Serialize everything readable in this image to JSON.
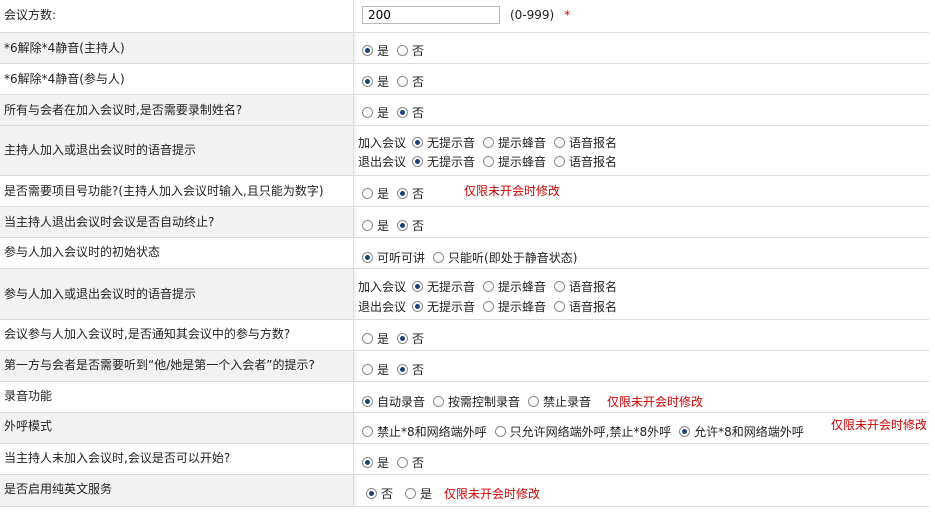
{
  "rows": [
    {
      "label": "会议方数:",
      "input_value": "200",
      "hint": "(0-999)",
      "required_mark": "*"
    },
    {
      "label": "*6解除*4静音(主持人)",
      "options": [
        "是",
        "否"
      ]
    },
    {
      "label": "*6解除*4静音(参与人)",
      "options": [
        "是",
        "否"
      ]
    },
    {
      "label": "所有与会者在加入会议时,是否需要录制姓名?",
      "options": [
        "是",
        "否"
      ]
    },
    {
      "label": "主持人加入或退出会议时的语音提示",
      "lines": [
        {
          "prefix": "加入会议",
          "options": [
            "无提示音",
            "提示蜂音",
            "语音报名"
          ]
        },
        {
          "prefix": "退出会议",
          "options": [
            "无提示音",
            "提示蜂音",
            "语音报名"
          ]
        }
      ]
    },
    {
      "label": "是否需要项目号功能?(主持人加入会议时输入,且只能为数字)",
      "options": [
        "是",
        "否"
      ],
      "note": "仅限未开会时修改"
    },
    {
      "label": "当主持人退出会议时会议是否自动终止?",
      "options": [
        "是",
        "否"
      ]
    },
    {
      "label": "参与人加入会议时的初始状态",
      "options": [
        "可听可讲",
        "只能听(即处于静音状态)"
      ]
    },
    {
      "label": "参与人加入或退出会议时的语音提示",
      "lines": [
        {
          "prefix": "加入会议",
          "options": [
            "无提示音",
            "提示蜂音",
            "语音报名"
          ]
        },
        {
          "prefix": "退出会议",
          "options": [
            "无提示音",
            "提示蜂音",
            "语音报名"
          ]
        }
      ]
    },
    {
      "label": "会议参与人加入会议时,是否通知其会议中的参与方数?",
      "options": [
        "是",
        "否"
      ]
    },
    {
      "label": "第一方与会者是否需要听到“他/她是第一个入会者”的提示?",
      "options": [
        "是",
        "否"
      ]
    },
    {
      "label": "录音功能",
      "options": [
        "自动录音",
        "按需控制录音",
        "禁止录音"
      ],
      "note": "仅限未开会时修改"
    },
    {
      "label": "外呼模式",
      "options": [
        "禁止*8和网络端外呼",
        "只允许网络端外呼,禁止*8外呼",
        "允许*8和网络端外呼"
      ],
      "note": "仅限未开会时修改"
    },
    {
      "label": "当主持人未加入会议时,会议是否可以开始?",
      "options": [
        "是",
        "否"
      ]
    },
    {
      "label": "是否启用纯英文服务",
      "options": [
        "否",
        "是"
      ],
      "note": "仅限未开会时修改"
    }
  ],
  "colors": {
    "note": "#cc0000",
    "radio_dot": "#1f3f7a",
    "alt_row": "#f2f2f2"
  }
}
